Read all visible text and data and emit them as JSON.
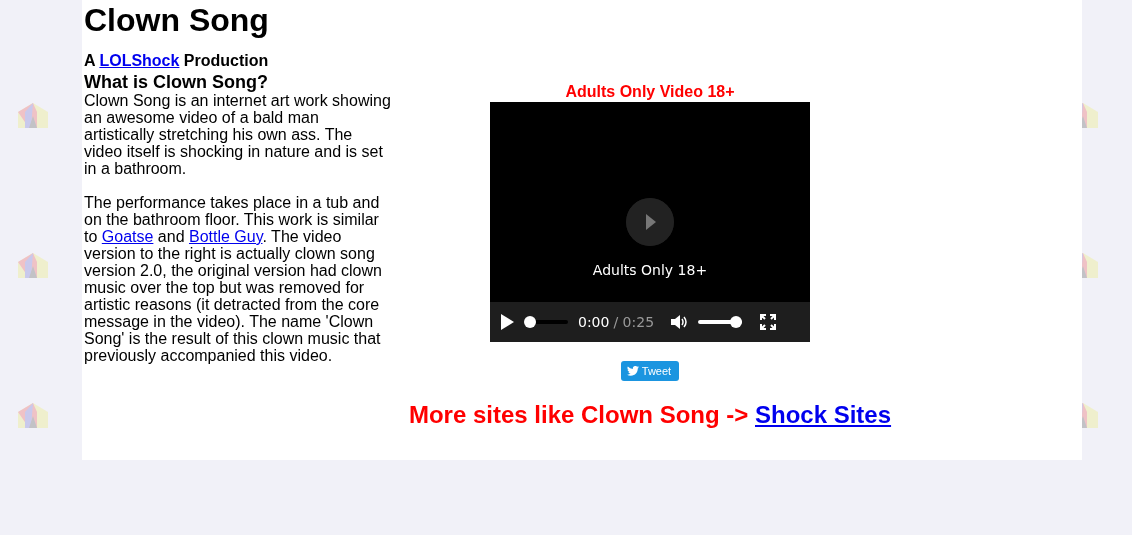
{
  "title": "Clown Song",
  "byline": [
    {
      "kind": "text",
      "text": "A "
    },
    {
      "kind": "link",
      "text": "LOLShock"
    },
    {
      "kind": "text",
      "text": " Production"
    }
  ],
  "heading": "What is Clown Song?",
  "paragraphs": [
    [
      {
        "kind": "text",
        "text": "Clown Song is an internet art work showing an awesome video of a bald man artistically stretching his own ass. The video itself is shocking in nature and is set in a bathroom."
      }
    ],
    [
      {
        "kind": "text",
        "text": "The performance takes place in a tub and on the bathroom floor. This work is similar to "
      },
      {
        "kind": "link",
        "text": "Goatse"
      },
      {
        "kind": "text",
        "text": " and "
      },
      {
        "kind": "link",
        "text": "Bottle Guy"
      },
      {
        "kind": "text",
        "text": ". The video version to the right is actually clown song version 2.0, the original version had clown music over the top but was removed for artistic reasons (it detracted from the core message in the video). The name 'Clown Song' is the result of this clown music that previously accompanied this video."
      }
    ]
  ],
  "video": {
    "caption": "Adults Only Video 18+",
    "overlay": "Adults Only 18+",
    "progress": {
      "level": 0
    },
    "current_time": "0:00",
    "duration": "/ 0:25",
    "volume": {
      "level": 1
    }
  },
  "tweet_button": "Tweet",
  "footer": [
    {
      "kind": "text",
      "text": "More sites like Clown Song -> "
    },
    {
      "kind": "link",
      "text": "Shock Sites"
    }
  ]
}
